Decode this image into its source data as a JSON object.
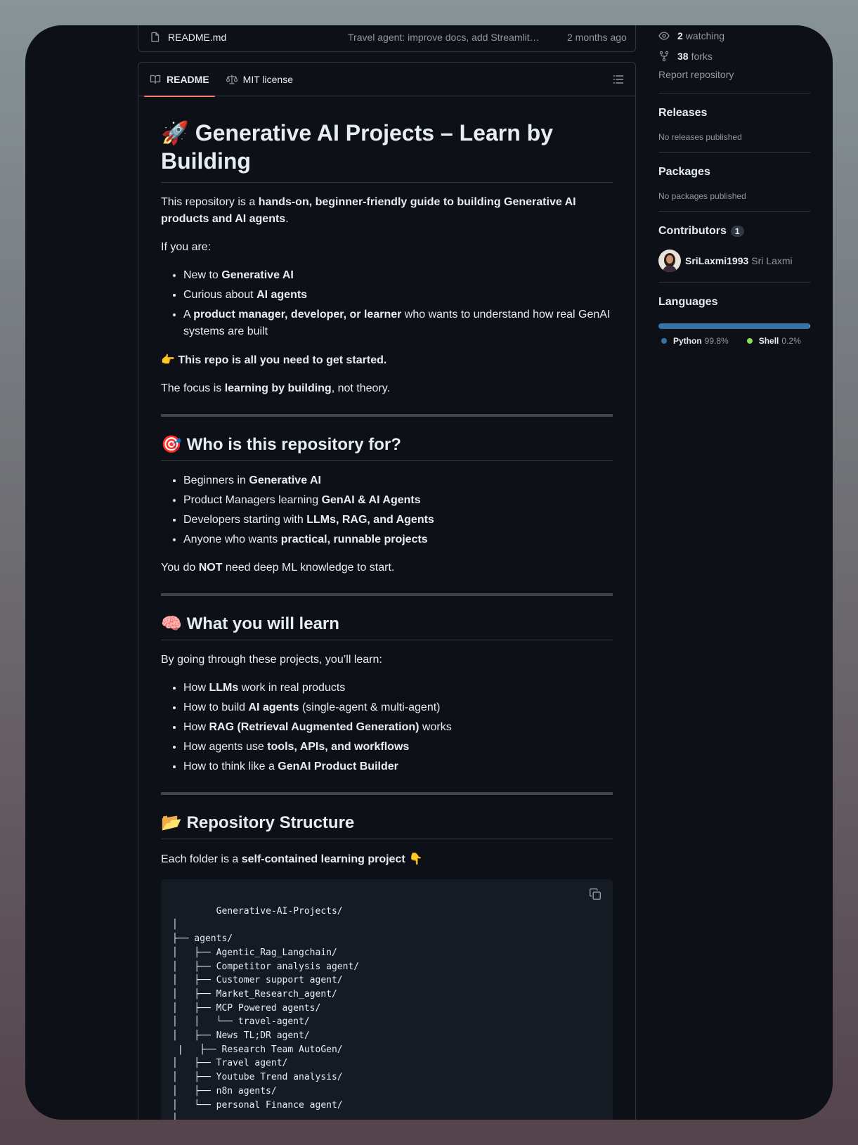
{
  "file_row": {
    "name": "README.md",
    "commit": "Travel agent: improve docs, add Streamlit UI",
    "time": "2 months ago"
  },
  "tabs": [
    {
      "label": "README",
      "active": true
    },
    {
      "label": "MIT license",
      "active": false
    }
  ],
  "readme": {
    "title_emoji": "🚀",
    "title": "Generative AI Projects – Learn by Building",
    "intro": {
      "pre": "This repository is a ",
      "bold": "hands-on, beginner-friendly guide to building Generative AI products and AI agents",
      "post": "."
    },
    "if_you_are": "If you are:",
    "audience": [
      {
        "pre": "New to ",
        "bold": "Generative AI",
        "post": ""
      },
      {
        "pre": "Curious about ",
        "bold": "AI agents",
        "post": ""
      },
      {
        "pre": "A ",
        "bold": "product manager, developer, or learner",
        "post": " who wants to understand how real GenAI systems are built"
      }
    ],
    "callout": {
      "emoji": "👉",
      "bold": "This repo is all you need to get started."
    },
    "focus": {
      "pre": "The focus is ",
      "bold": "learning by building",
      "post": ", not theory."
    },
    "sec_who": {
      "emoji": "🎯",
      "heading": "Who is this repository for?",
      "items": [
        {
          "pre": "Beginners in ",
          "bold": "Generative AI"
        },
        {
          "pre": "Product Managers learning ",
          "bold": "GenAI & AI Agents"
        },
        {
          "pre": "Developers starting with ",
          "bold": "LLMs, RAG, and Agents"
        },
        {
          "pre": "Anyone who wants ",
          "bold": "practical, runnable projects"
        }
      ],
      "note": {
        "pre": "You do ",
        "bold": "NOT",
        "post": " need deep ML knowledge to start."
      }
    },
    "sec_learn": {
      "emoji": "🧠",
      "heading": "What you will learn",
      "intro": "By going through these projects, you’ll learn:",
      "items": [
        {
          "pre": "How ",
          "bold": "LLMs",
          "post": " work in real products"
        },
        {
          "pre": "How to build ",
          "bold": "AI agents",
          "post": " (single-agent & multi-agent)"
        },
        {
          "pre": "How ",
          "bold": "RAG (Retrieval Augmented Generation)",
          "post": " works"
        },
        {
          "pre": "How agents use ",
          "bold": "tools, APIs, and workflows",
          "post": ""
        },
        {
          "pre": "How to think like a ",
          "bold": "GenAI Product Builder",
          "post": ""
        }
      ]
    },
    "sec_structure": {
      "emoji": "📂",
      "heading": "Repository Structure",
      "intro": {
        "pre": "Each folder is a ",
        "bold": "self-contained learning project",
        "emoji": " 👇"
      },
      "code": "Generative-AI-Projects/\n│\n├── agents/\n│   ├── Agentic_Rag_Langchain/\n│   ├── Competitor analysis agent/\n│   ├── Customer support agent/\n│   ├── Market_Research_agent/\n│   ├── MCP Powered agents/\n│   │   └── travel-agent/\n│   ├── News TL;DR agent/\n |   ├── Research Team AutoGen/\n│   ├── Travel agent/\n│   ├── Youtube Trend analysis/\n│   ├── n8n agents/\n│   └── personal Finance agent/\n│\n├── LICENSE"
    }
  },
  "sidebar": {
    "watching": {
      "count": "2",
      "label": "watching"
    },
    "forks": {
      "count": "38",
      "label": "forks"
    },
    "report": "Report repository",
    "releases": {
      "heading": "Releases",
      "empty": "No releases published"
    },
    "packages": {
      "heading": "Packages",
      "empty": "No packages published"
    },
    "contributors": {
      "heading": "Contributors",
      "count": "1",
      "login": "SriLaxmi1993",
      "name": "Sri Laxmi"
    },
    "languages": {
      "heading": "Languages",
      "items": [
        {
          "name": "Python",
          "pct": "99.8%",
          "color": "#3572a5"
        },
        {
          "name": "Shell",
          "pct": "0.2%",
          "color": "#89e051"
        }
      ]
    }
  }
}
